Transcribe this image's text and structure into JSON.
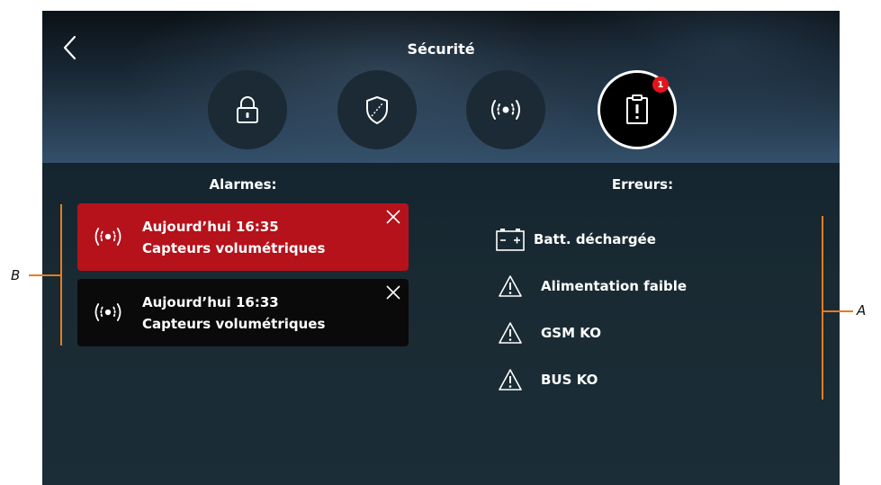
{
  "header": {
    "title": "Sécurité"
  },
  "tabs": [
    {
      "icon": "lock-icon",
      "active": false
    },
    {
      "icon": "shield-icon",
      "active": false
    },
    {
      "icon": "signal-icon",
      "active": false
    },
    {
      "icon": "clipboard-alert-icon",
      "active": true,
      "badge": "1"
    }
  ],
  "alarms": {
    "heading": "Alarmes:",
    "items": [
      {
        "time": "Aujourd’hui 16:35",
        "label": "Capteurs volumétriques",
        "color": "#b5121b"
      },
      {
        "time": "Aujourd’hui 16:33",
        "label": "Capteurs volumétriques",
        "color": "#0a0a0a"
      }
    ]
  },
  "errors": {
    "heading": "Erreurs:",
    "items": [
      {
        "icon": "battery-icon",
        "label": "Batt. déchargée"
      },
      {
        "icon": "warning-icon",
        "label": "Alimentation faible"
      },
      {
        "icon": "warning-icon",
        "label": "GSM KO"
      },
      {
        "icon": "warning-icon",
        "label": "BUS KO"
      }
    ]
  },
  "callouts": {
    "left": "B",
    "right": "A"
  },
  "colors": {
    "accent": "#e87c1c",
    "alarm_active": "#b5121b",
    "badge": "#e3141c"
  }
}
